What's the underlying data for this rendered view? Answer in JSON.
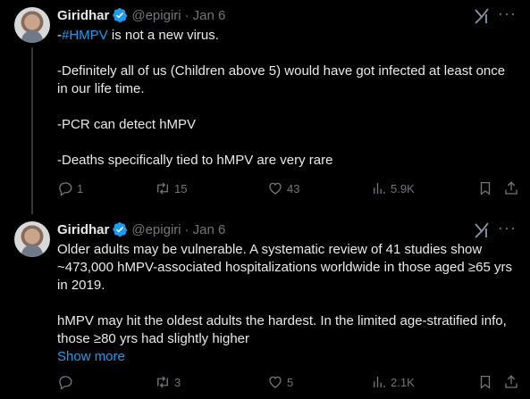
{
  "tweets": [
    {
      "author_name": "Giridhar",
      "handle": "@epigiri",
      "date": "Jan 6",
      "hashtag": "#HMPV",
      "first_line_rest": " is not a new virus.",
      "first_line_prefix": "-",
      "paragraphs": [
        "-Definitely all of us (Children above 5) would have got infected at least once in our life time.",
        "-PCR can detect hMPV",
        "-Deaths specifically tied to hMPV are very rare"
      ],
      "replies": "1",
      "reposts": "15",
      "likes": "43",
      "views": "5.9K"
    },
    {
      "author_name": "Giridhar",
      "handle": "@epigiri",
      "date": "Jan 6",
      "paragraphs": [
        "Older adults may be vulnerable. A systematic review of 41 studies show ~473,000 hMPV-associated hospitalizations worldwide in those aged ≥65 yrs in 2019.",
        "hMPV may hit the oldest adults the hardest. In the limited age-stratified info, those ≥80 yrs had slightly higher"
      ],
      "show_more": "Show more",
      "replies": "",
      "reposts": "3",
      "likes": "5",
      "views": "2.1K"
    }
  ],
  "icons": {
    "verified": "verified-badge-icon",
    "grok": "grok-icon",
    "more": "more-icon",
    "reply": "reply-icon",
    "repost": "repost-icon",
    "like": "like-icon",
    "views": "views-icon",
    "bookmark": "bookmark-icon",
    "share": "share-icon"
  },
  "colors": {
    "background": "#000000",
    "text": "#e7e9ea",
    "muted": "#71767b",
    "link": "#1d9bf0",
    "thread_line": "#333639"
  }
}
